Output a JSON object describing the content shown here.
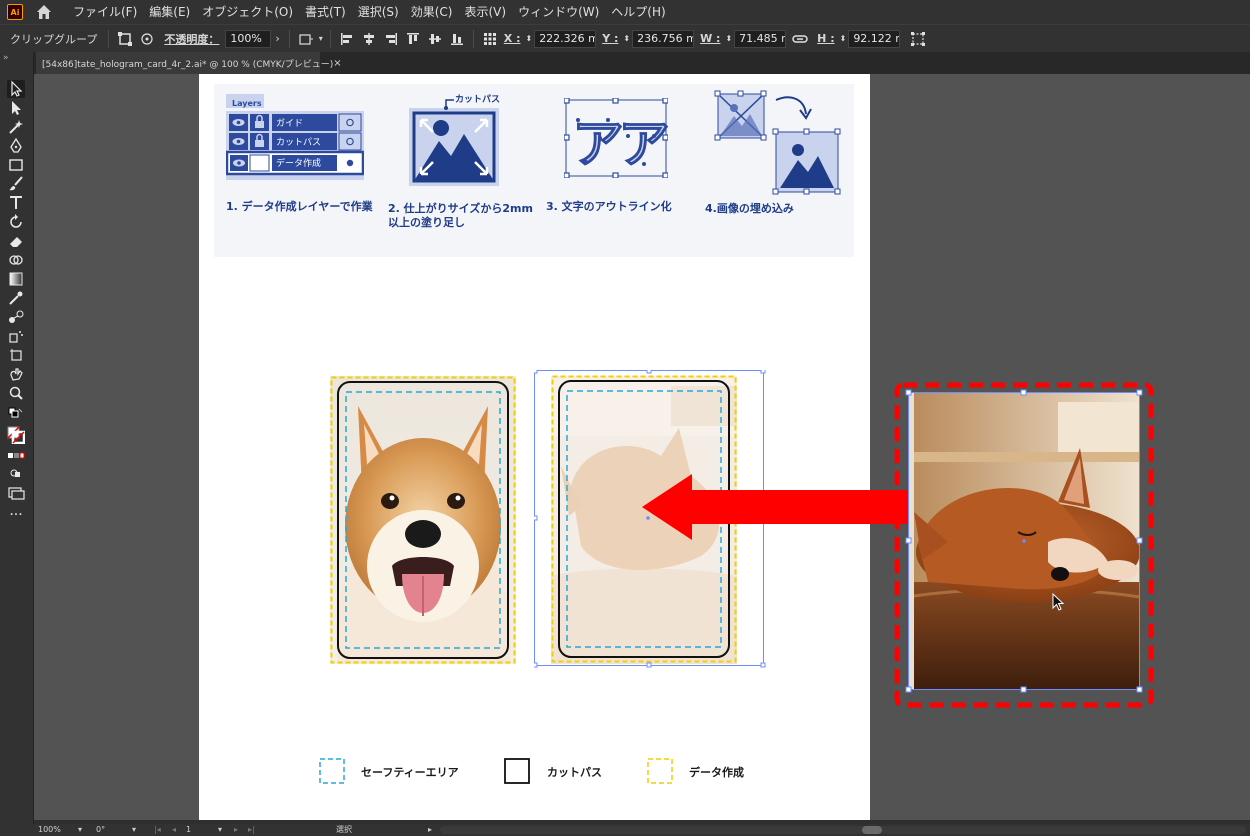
{
  "app": {
    "logo_text": "Ai"
  },
  "menu": [
    {
      "label": "ファイル(F)"
    },
    {
      "label": "編集(E)"
    },
    {
      "label": "オブジェクト(O)"
    },
    {
      "label": "書式(T)"
    },
    {
      "label": "選択(S)"
    },
    {
      "label": "効果(C)"
    },
    {
      "label": "表示(V)"
    },
    {
      "label": "ウィンドウ(W)"
    },
    {
      "label": "ヘルプ(H)"
    }
  ],
  "control_bar": {
    "selection_type": "クリップグループ",
    "opacity_label": "不透明度：",
    "opacity_value": "100%",
    "x_label": "X :",
    "x_value": "222.326 mı",
    "y_label": "Y :",
    "y_value": "236.756 mı",
    "w_label": "W :",
    "w_value": "71.485 mr",
    "h_label": "H :",
    "h_value": "92.122 mr"
  },
  "document_tab": {
    "title": "[54x86]tate_hologram_card_4r_2.ai* @ 100 % (CMYK/プレビュー)",
    "close": "×"
  },
  "guide": {
    "layers_title": "Layers",
    "layer_rows": [
      {
        "name": "ガイド"
      },
      {
        "name": "カットパス"
      },
      {
        "name": "データ作成"
      }
    ],
    "cutpath_callout": "カットパス",
    "outline_glyphs": "アア",
    "steps": [
      {
        "label": "1. データ作成レイヤーで作業"
      },
      {
        "label": "2. 仕上がりサイズから2mm"
      },
      {
        "label": "以上の塗り足し"
      },
      {
        "label": "3. 文字のアウトライン化"
      },
      {
        "label": "4.画像の埋め込み"
      }
    ]
  },
  "legend": [
    {
      "label": "セーフティーエリア"
    },
    {
      "label": "カットパス"
    },
    {
      "label": "データ作成"
    }
  ],
  "status_bar": {
    "zoom": "100%",
    "rotation": "0°",
    "artboard": "1",
    "mode": "選択"
  },
  "colors": {
    "ui_dark": "#323232",
    "canvas": "#535353",
    "guide_blue": "#1f3c88",
    "safety_cyan": "#28a8d8",
    "bleed_yellow": "#f0d000",
    "highlight_red": "#ff0000",
    "selection_blue": "#6c8cff"
  }
}
